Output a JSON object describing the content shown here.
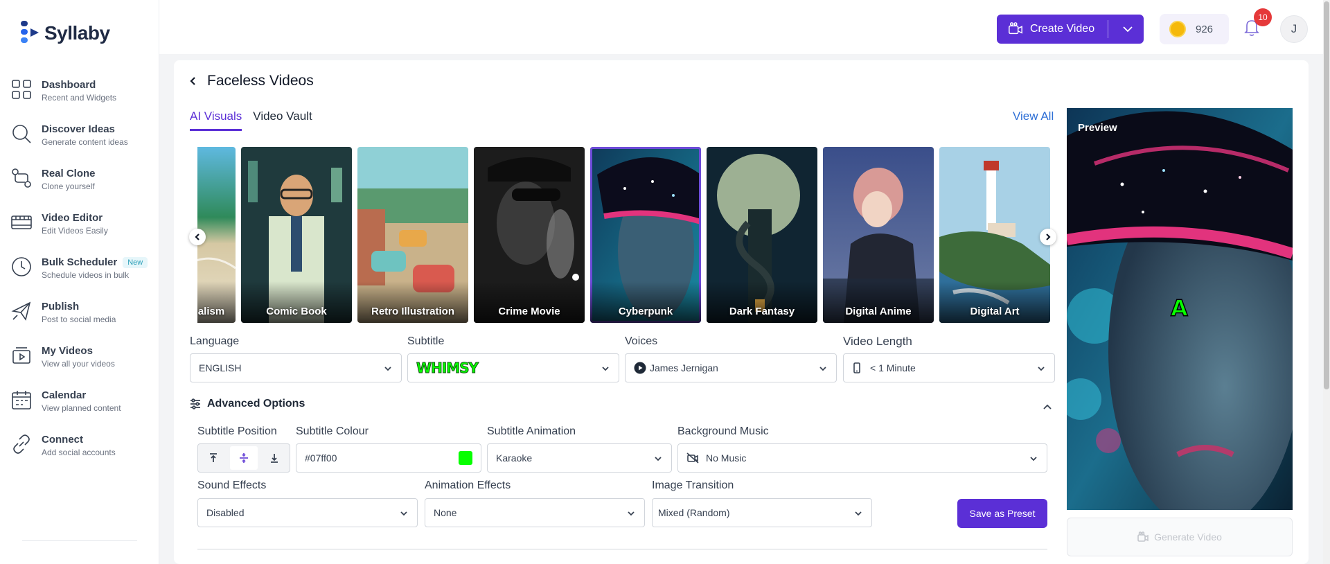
{
  "brand": {
    "name": "Syllaby"
  },
  "sidebar": {
    "items": [
      {
        "title": "Dashboard",
        "sub": "Recent and Widgets",
        "icon": "grid-icon"
      },
      {
        "title": "Discover Ideas",
        "sub": "Generate content ideas",
        "icon": "search-icon"
      },
      {
        "title": "Real Clone",
        "sub": "Clone yourself",
        "icon": "clone-icon"
      },
      {
        "title": "Video Editor",
        "sub": "Edit Videos Easily",
        "icon": "film-icon"
      },
      {
        "title": "Bulk Scheduler",
        "sub": "Schedule videos in bulk",
        "icon": "clock-icon",
        "badge": "New"
      },
      {
        "title": "Publish",
        "sub": "Post to social media",
        "icon": "send-icon"
      },
      {
        "title": "My Videos",
        "sub": "View all your videos",
        "icon": "videos-icon"
      },
      {
        "title": "Calendar",
        "sub": "View planned content",
        "icon": "calendar-icon"
      },
      {
        "title": "Connect",
        "sub": "Add social accounts",
        "icon": "link-icon"
      }
    ]
  },
  "topbar": {
    "create_label": "Create Video",
    "credits": "926",
    "notifications": "10",
    "avatar_initial": "J"
  },
  "page": {
    "title": "Faceless Videos",
    "tabs": [
      "AI Visuals",
      "Video Vault"
    ],
    "active_tab": "AI Visuals",
    "view_all": "View All"
  },
  "styles": [
    {
      "name": "alism",
      "colors": [
        "#3aa3c9",
        "#e8dcc0"
      ]
    },
    {
      "name": "Comic Book",
      "colors": [
        "#1f3a3d",
        "#d9e6cc"
      ]
    },
    {
      "name": "Retro Illustration",
      "colors": [
        "#6fb6a4",
        "#e0a85a"
      ]
    },
    {
      "name": "Crime Movie",
      "colors": [
        "#1a1a1a",
        "#8a8a8a"
      ]
    },
    {
      "name": "Cyberpunk",
      "colors": [
        "#0d2236",
        "#e2337d"
      ],
      "selected": true
    },
    {
      "name": "Dark Fantasy",
      "colors": [
        "#0e2230",
        "#5d7d7a"
      ]
    },
    {
      "name": "Digital Anime",
      "colors": [
        "#2c3a66",
        "#d9a38f"
      ]
    },
    {
      "name": "Digital Art",
      "colors": [
        "#7fb8d8",
        "#3d5d3a"
      ]
    }
  ],
  "form": {
    "language_label": "Language",
    "language_value": "ENGLISH",
    "subtitle_label": "Subtitle",
    "subtitle_value": "WHIMSY",
    "voices_label": "Voices",
    "voices_value": "James Jernigan",
    "length_label": "Video Length",
    "length_value": "< 1 Minute"
  },
  "advanced": {
    "title": "Advanced Options",
    "position_label": "Subtitle Position",
    "colour_label": "Subtitle Colour",
    "colour_value": "#07ff00",
    "colour_hex": "#07ff00",
    "animation_label": "Subtitle Animation",
    "animation_value": "Karaoke",
    "music_label": "Background Music",
    "music_value": "No Music",
    "sfx_label": "Sound Effects",
    "sfx_value": "Disabled",
    "anim_fx_label": "Animation Effects",
    "anim_fx_value": "None",
    "transition_label": "Image Transition",
    "transition_value": "Mixed (Random)",
    "save_preset": "Save as Preset"
  },
  "preview": {
    "label": "Preview",
    "subtitle_sample": "A",
    "generate_label": "Generate Video"
  },
  "colors": {
    "accent": "#5b2fd6",
    "link": "#2e6fd6",
    "subtitle_color": "#07ff00"
  }
}
